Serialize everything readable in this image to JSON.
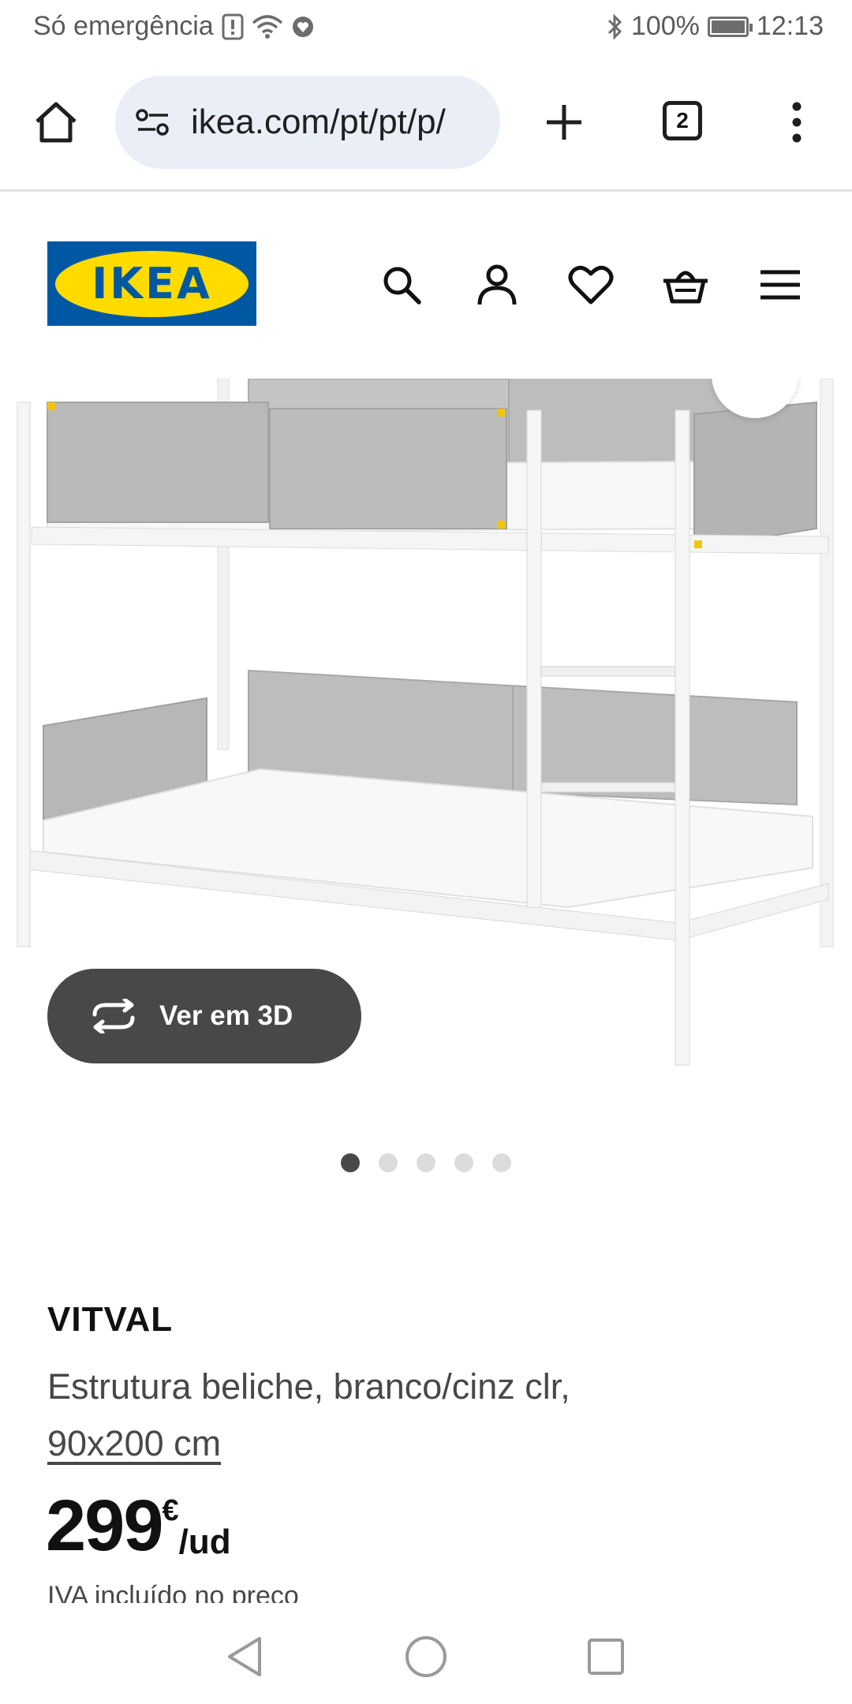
{
  "status_bar": {
    "carrier_text": "Só emergência",
    "battery_text": "100%",
    "battery_level": 1.0,
    "time": "12:13",
    "icons": [
      "alert-icon",
      "wifi-icon",
      "shield-heart-icon",
      "bluetooth-icon",
      "battery-icon"
    ]
  },
  "browser": {
    "url": "ikea.com/pt/pt/p/",
    "tab_count": "2",
    "icons": [
      "home-icon",
      "tune-icon",
      "plus-icon",
      "tabs-icon",
      "more-vertical-icon"
    ]
  },
  "site_header": {
    "logo_text": "IKEA",
    "brand_blue": "#0058a3",
    "brand_yellow": "#ffdb00",
    "icons": [
      "search-icon",
      "user-icon",
      "heart-icon",
      "basket-icon",
      "menu-icon"
    ]
  },
  "product_gallery": {
    "view_3d_label": "Ver em 3D",
    "image_count": 5,
    "active_image": 1
  },
  "product": {
    "name": "VITVAL",
    "description": "Estrutura beliche, branco/cinz clr,",
    "size": "90x200 cm",
    "price": "299",
    "currency": "€",
    "unit": "/ud",
    "vat_note": "IVA incluído no preço"
  },
  "system_nav": {
    "icons": [
      "back-icon",
      "home-circle-icon",
      "recents-icon"
    ]
  }
}
